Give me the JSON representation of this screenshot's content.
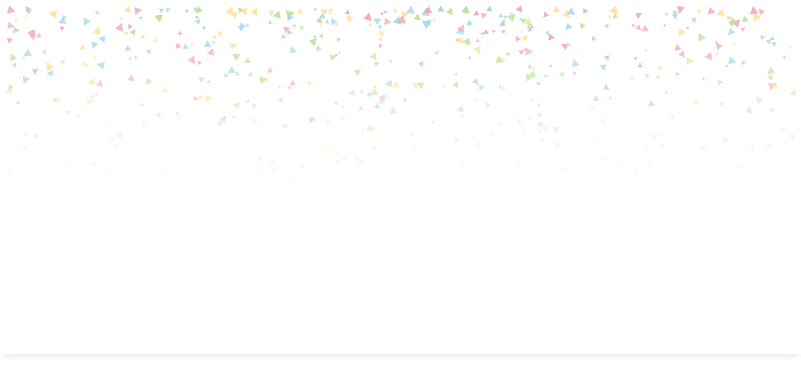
{
  "background": {
    "card_color": "#ffffff",
    "shadow_color": "#e6e9ee"
  },
  "confetti": {
    "shape": "triangle",
    "colors": [
      "#f4a7b4",
      "#a6d8e8",
      "#b8e39a",
      "#fde19a"
    ]
  }
}
